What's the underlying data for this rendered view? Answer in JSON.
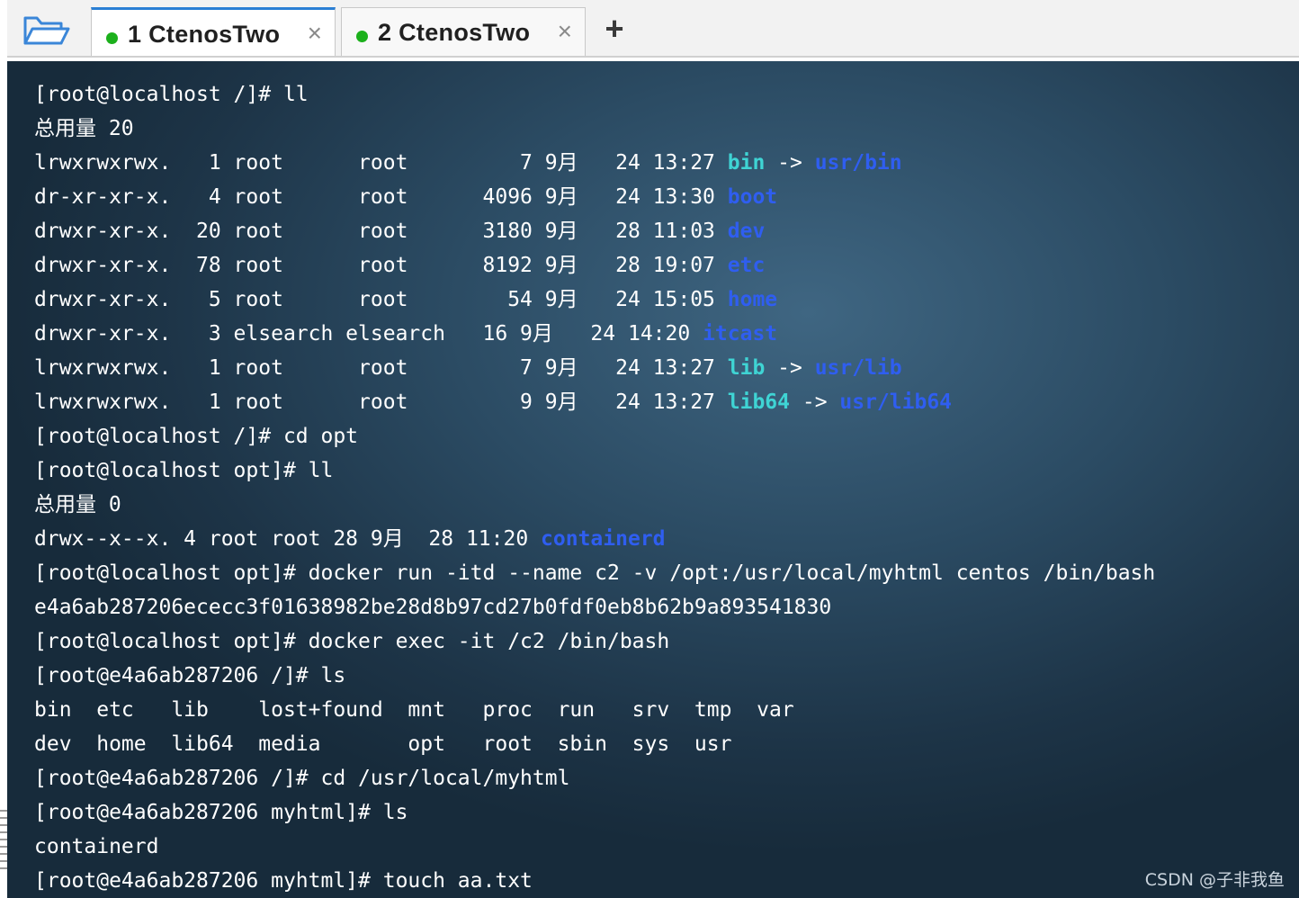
{
  "tabs": [
    {
      "label": "1  CtenosTwo",
      "active": true,
      "status_color": "#1cb01c",
      "close_glyph": "×"
    },
    {
      "label": "2  CtenosTwo",
      "active": false,
      "status_color": "#1cb01c",
      "close_glyph": "×"
    }
  ],
  "toolbar": {
    "folder_icon": "folder-open-icon",
    "add_tab_glyph": "+"
  },
  "colors": {
    "symlink": "#3fd4d4",
    "directory": "#2f5ef0",
    "accent": "#2a7fd4"
  },
  "terminal": {
    "lines": [
      [
        {
          "t": "[root@localhost /]# ll"
        }
      ],
      [
        {
          "t": "总用量 20"
        }
      ],
      [
        {
          "t": "lrwxrwxrwx.   1 root      root         7 9月   24 13:27 "
        },
        {
          "t": "bin",
          "c": "cyan"
        },
        {
          "t": " -> "
        },
        {
          "t": "usr/bin",
          "c": "blue"
        }
      ],
      [
        {
          "t": "dr-xr-xr-x.   4 root      root      4096 9月   24 13:30 "
        },
        {
          "t": "boot",
          "c": "blue"
        }
      ],
      [
        {
          "t": "drwxr-xr-x.  20 root      root      3180 9月   28 11:03 "
        },
        {
          "t": "dev",
          "c": "blue"
        }
      ],
      [
        {
          "t": "drwxr-xr-x.  78 root      root      8192 9月   28 19:07 "
        },
        {
          "t": "etc",
          "c": "blue"
        }
      ],
      [
        {
          "t": "drwxr-xr-x.   5 root      root        54 9月   24 15:05 "
        },
        {
          "t": "home",
          "c": "blue"
        }
      ],
      [
        {
          "t": "drwxr-xr-x.   3 elsearch elsearch   16 9月   24 14:20 "
        },
        {
          "t": "itcast",
          "c": "blue"
        }
      ],
      [
        {
          "t": "lrwxrwxrwx.   1 root      root         7 9月   24 13:27 "
        },
        {
          "t": "lib",
          "c": "cyan"
        },
        {
          "t": " -> "
        },
        {
          "t": "usr/lib",
          "c": "blue"
        }
      ],
      [
        {
          "t": "lrwxrwxrwx.   1 root      root         9 9月   24 13:27 "
        },
        {
          "t": "lib64",
          "c": "cyan"
        },
        {
          "t": " -> "
        },
        {
          "t": "usr/lib64",
          "c": "blue"
        }
      ],
      [
        {
          "t": "[root@localhost /]# cd opt"
        }
      ],
      [
        {
          "t": "[root@localhost opt]# ll"
        }
      ],
      [
        {
          "t": "总用量 0"
        }
      ],
      [
        {
          "t": "drwx--x--x. 4 root root 28 9月  28 11:20 "
        },
        {
          "t": "containerd",
          "c": "blue"
        }
      ],
      [
        {
          "t": "[root@localhost opt]# docker run -itd --name c2 -v /opt:/usr/local/myhtml centos /bin/bash"
        }
      ],
      [
        {
          "t": "e4a6ab287206ececc3f01638982be28d8b97cd27b0fdf0eb8b62b9a893541830"
        }
      ],
      [
        {
          "t": "[root@localhost opt]# docker exec -it /c2 /bin/bash"
        }
      ],
      [
        {
          "t": "[root@e4a6ab287206 /]# ls"
        }
      ],
      [
        {
          "t": "bin  etc   lib    lost+found  mnt   proc  run   srv  tmp  var"
        }
      ],
      [
        {
          "t": "dev  home  lib64  media       opt   root  sbin  sys  usr"
        }
      ],
      [
        {
          "t": "[root@e4a6ab287206 /]# cd /usr/local/myhtml"
        }
      ],
      [
        {
          "t": "[root@e4a6ab287206 myhtml]# ls"
        }
      ],
      [
        {
          "t": "containerd"
        }
      ],
      [
        {
          "t": "[root@e4a6ab287206 myhtml]# touch aa.txt"
        }
      ]
    ]
  },
  "watermark": "CSDN @子非我鱼"
}
